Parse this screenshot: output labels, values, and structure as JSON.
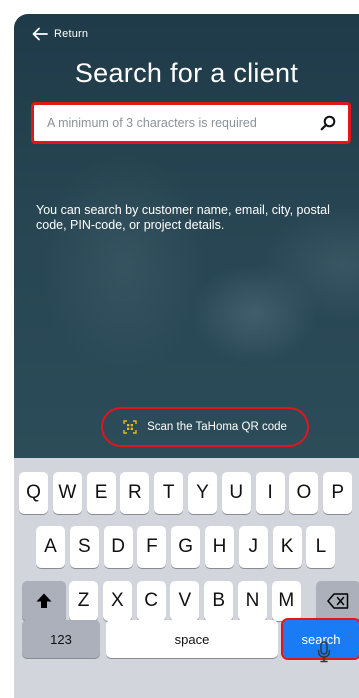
{
  "header": {
    "return_label": "Return",
    "title": "Search for a client"
  },
  "search": {
    "placeholder": "A minimum of 3 characters is required",
    "value": ""
  },
  "help_text": "You can search by customer name, email, city, postal code, PIN-code, or project details.",
  "qr_button": {
    "label": "Scan the TaHoma QR code",
    "icon": "qr-scan-icon"
  },
  "keyboard": {
    "row1": [
      "Q",
      "W",
      "E",
      "R",
      "T",
      "Y",
      "U",
      "I",
      "O",
      "P"
    ],
    "row2": [
      "A",
      "S",
      "D",
      "F",
      "G",
      "H",
      "J",
      "K",
      "L"
    ],
    "row3": [
      "Z",
      "X",
      "C",
      "V",
      "B",
      "N",
      "M"
    ],
    "numbers_key": "123",
    "space_key": "space",
    "search_key": "search",
    "shift_icon": "shift-icon",
    "backspace_icon": "backspace-icon",
    "mic_icon": "microphone-icon"
  },
  "colors": {
    "highlight": "#e0161c",
    "search_key": "#1a7cf5",
    "background": "#274552"
  }
}
